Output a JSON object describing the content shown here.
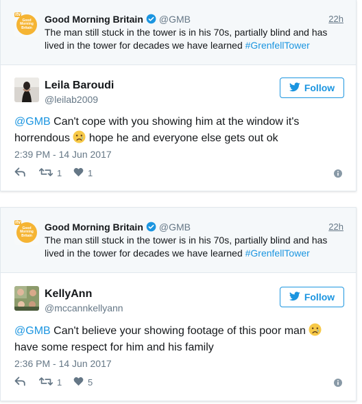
{
  "tweets": [
    {
      "quoted": {
        "name": "Good Morning Britain",
        "handle": "@GMB",
        "time": "22h",
        "text_before": "The man still stuck in the tower is in his 70s, partially blind and has lived in the tower for decades we have learned ",
        "hashtag": "#GrenfellTower",
        "avatar_badge": "itv",
        "avatar_text": "Good Morning Britain"
      },
      "author": {
        "name": "Leila Baroudi",
        "handle": "@leilab2009"
      },
      "follow_label": "Follow",
      "text": {
        "mention": "@GMB",
        "before_emoji": " Can't cope with you showing him at the window it's horrendous ",
        "after_emoji": " hope he and everyone else gets out ok"
      },
      "timestamp": "2:39 PM - 14 Jun 2017",
      "retweets": "1",
      "likes": "1"
    },
    {
      "quoted": {
        "name": "Good Morning Britain",
        "handle": "@GMB",
        "time": "22h",
        "text_before": "The man still stuck in the tower is in his 70s, partially blind and has lived in the tower for decades we have learned ",
        "hashtag": "#GrenfellTower",
        "avatar_badge": "itv",
        "avatar_text": "Good Morning Britain"
      },
      "author": {
        "name": "KellyAnn",
        "handle": "@mccannkellyann"
      },
      "follow_label": "Follow",
      "text": {
        "mention": "@GMB",
        "before_emoji": " Can't believe your showing footage of this poor man ",
        "after_emoji": " have some respect for him and his family"
      },
      "timestamp": "2:36 PM - 14 Jun 2017",
      "retweets": "1",
      "likes": "5"
    }
  ],
  "colors": {
    "accent": "#1b95e0",
    "secondary_text": "#657786",
    "quoted_bg": "#f5f8fa",
    "gmb_yellow": "#f5b433"
  },
  "icons": [
    "verified-badge-icon",
    "twitter-bird-icon",
    "reply-icon",
    "retweet-icon",
    "heart-icon",
    "info-icon",
    "crying-face-emoji"
  ]
}
